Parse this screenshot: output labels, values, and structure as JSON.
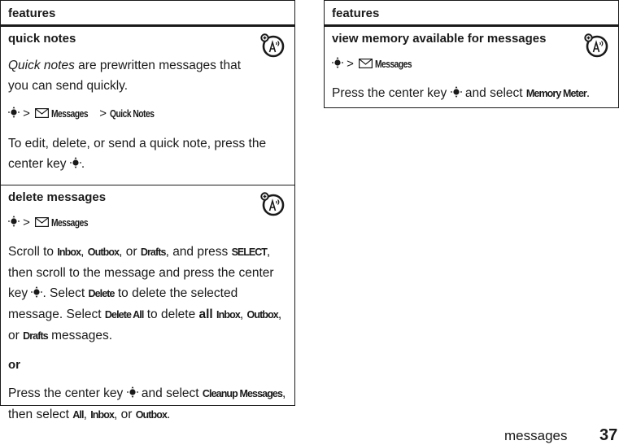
{
  "left_table": {
    "header": "features",
    "rows": [
      {
        "title": "quick notes",
        "icon": "network-feature-icon",
        "intro_italic": "Quick notes",
        "intro_rest": " are prewritten messages that you can send quickly.",
        "path": [
          "Messages",
          "Quick Notes"
        ],
        "body": "To edit, delete, or send a quick note, press the center key",
        "body_end": "."
      },
      {
        "title": "delete messages",
        "icon": "network-feature-icon",
        "path": [
          "Messages"
        ],
        "p1": {
          "t1": "Scroll to ",
          "k1": "Inbox",
          "t2": ", ",
          "k2": "Outbox",
          "t3": ", or ",
          "k3": "Drafts",
          "t4": ", and press ",
          "k4": "SELECT",
          "t5": ", then scroll to the message and press the center key",
          "t6": ". Select ",
          "k5": "Delete",
          "t7": " to delete the selected message. Select ",
          "k6": "Delete All",
          "t8": " to delete ",
          "k7": "all",
          "t9": " ",
          "k8": "Inbox",
          "t10": ", ",
          "k9": "Outbox",
          "t11": ", or ",
          "k10": "Drafts",
          "t12": " messages."
        },
        "or": "or",
        "p2": {
          "t1": "Press the center key",
          "t2": " and select ",
          "k1": "Cleanup Messages",
          "t3": ", then select ",
          "k2": "All",
          "t4": ", ",
          "k3": "Inbox",
          "t5": ", or ",
          "k4": "Outbox",
          "t6": "."
        }
      }
    ]
  },
  "right_table": {
    "header": "features",
    "rows": [
      {
        "title": "view memory available for messages",
        "icon": "network-feature-icon",
        "path": [
          "Messages"
        ],
        "body1": "Press the center key",
        "body2": " and select ",
        "key": "Memory Meter",
        "body_end": "."
      }
    ]
  },
  "footer": {
    "section": "messages",
    "page_number": "37"
  },
  "path_separator": ">"
}
